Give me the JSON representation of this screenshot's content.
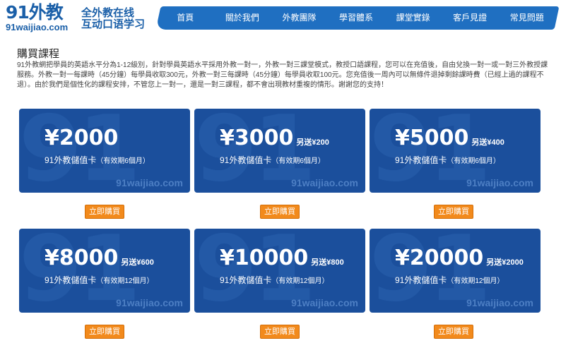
{
  "header": {
    "logo_main": "91外教",
    "logo_url": "91waijiao.com",
    "slogan_line1": "全外教在线",
    "slogan_line2": "互动口语学习",
    "nav": [
      "首頁",
      "關於我們",
      "外教團隊",
      "學習體系",
      "課堂實錄",
      "客戶見證",
      "常見問題"
    ],
    "nav_color": "#1f6fc1"
  },
  "main": {
    "title": "購買課程",
    "intro": "91外教網把學員的英語水平分為1-12級別，針對學員英語水平採用外教一對一，外教一對三課堂模式，教授口語課程，您可以在充值後，自由兌換一對一或一對三外教授課服務。外教一對一每課時（45分鐘）每學員收取300元，外教一對三每課時（45分鐘）每學員收取100元。您充值後一周內可以無條件退掉剩餘課時費（已經上過的課程不退）。由於我們是個性化的課程安排，不管您上一對一，還是一對三課程，都不會出現教材重複的情形。謝謝您的支持！",
    "watermark": "91waijiao.com",
    "card_color": "#1b4f9c",
    "buy_color": "#f28a1c",
    "cards": [
      {
        "price": "¥2000",
        "bonus": "",
        "desc": "91外教儲值卡",
        "validity": "（有效期6個月）",
        "buy": "立即購買"
      },
      {
        "price": "¥3000",
        "bonus": "另送¥200",
        "desc": "91外教儲值卡",
        "validity": "（有效期6個月）",
        "buy": "立即購買"
      },
      {
        "price": "¥5000",
        "bonus": "另送¥400",
        "desc": "91外教儲值卡",
        "validity": "（有效期6個月）",
        "buy": "立即購買"
      },
      {
        "price": "¥8000",
        "bonus": "另送¥600",
        "desc": "91外教儲值卡",
        "validity": "（有效期12個月）",
        "buy": "立即購買"
      },
      {
        "price": "¥10000",
        "bonus": "另送¥800",
        "desc": "91外教儲值卡",
        "validity": "（有效期12個月）",
        "buy": "立即購買"
      },
      {
        "price": "¥20000",
        "bonus": "另送¥2000",
        "desc": "91外教儲值卡",
        "validity": "（有效期12個月）",
        "buy": "立即購買"
      }
    ]
  }
}
